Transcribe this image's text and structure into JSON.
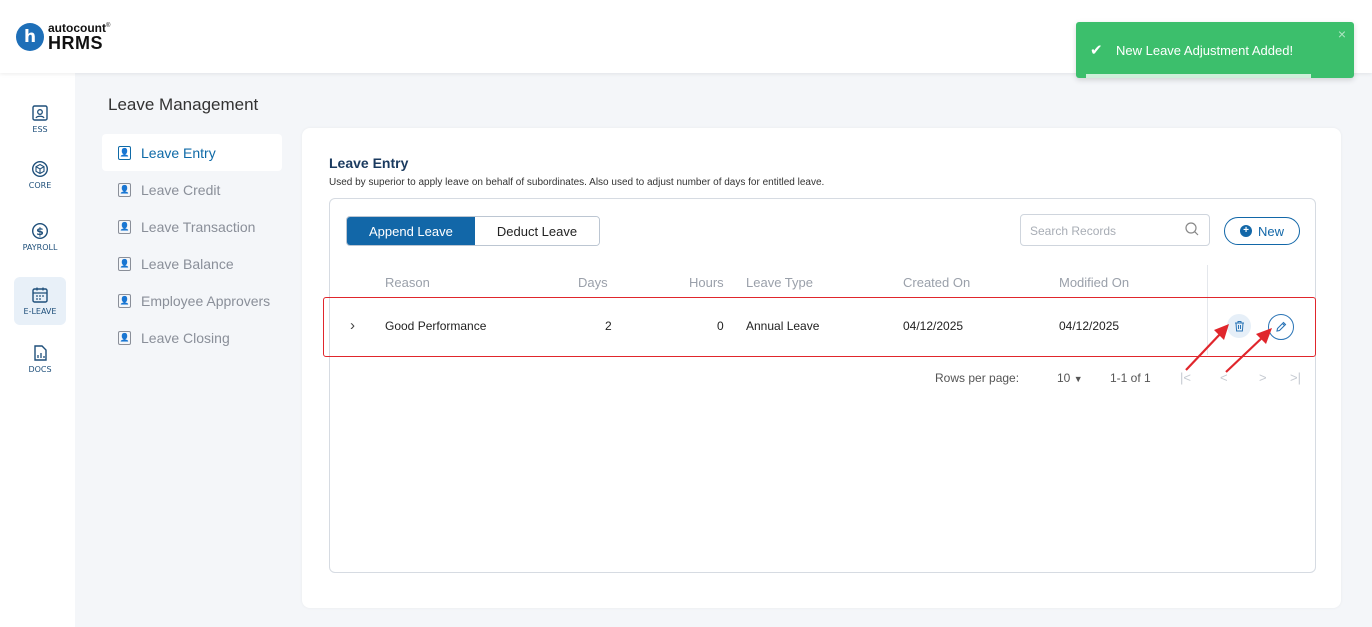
{
  "brand": {
    "logo_letter": "h",
    "top": "autocount",
    "mark": "®",
    "name": "HRMS"
  },
  "toast": {
    "message": "New Leave Adjustment Added!",
    "close": "×"
  },
  "sidebar": {
    "items": [
      {
        "label": "ESS",
        "icon": "id-card-icon"
      },
      {
        "label": "CORE",
        "icon": "cube-icon"
      },
      {
        "label": "PAYROLL",
        "icon": "dollar-icon"
      },
      {
        "label": "E-LEAVE",
        "icon": "calendar-icon",
        "active": true
      },
      {
        "label": "DOCS",
        "icon": "document-chart-icon"
      }
    ]
  },
  "page": {
    "title": "Leave Management"
  },
  "submenu": {
    "items": [
      {
        "label": "Leave Entry",
        "active": true
      },
      {
        "label": "Leave Credit"
      },
      {
        "label": "Leave Transaction"
      },
      {
        "label": "Leave Balance"
      },
      {
        "label": "Employee Approvers"
      },
      {
        "label": "Leave Closing"
      }
    ]
  },
  "card": {
    "title": "Leave Entry",
    "subtitle": "Used by superior to apply leave on behalf of subordinates. Also used to adjust number of days for entitled leave."
  },
  "toolbar": {
    "append_label": "Append Leave",
    "deduct_label": "Deduct Leave",
    "search_placeholder": "Search Records",
    "new_label": "New"
  },
  "table": {
    "headers": [
      "Reason",
      "Days",
      "Hours",
      "Leave Type",
      "Created On",
      "Modified On"
    ],
    "rows": [
      [
        "Good Performance",
        "2",
        "0",
        "Annual Leave",
        "04/12/2025",
        "04/12/2025"
      ]
    ]
  },
  "pagination": {
    "rows_label": "Rows per page:",
    "rows_value": "10",
    "range": "1-1 of 1",
    "first": "|<",
    "prev": "<",
    "next": ">",
    "last": ">|"
  },
  "colors": {
    "primary": "#1267a8",
    "toast": "#3cbf6c",
    "highlight": "#e0262c"
  }
}
